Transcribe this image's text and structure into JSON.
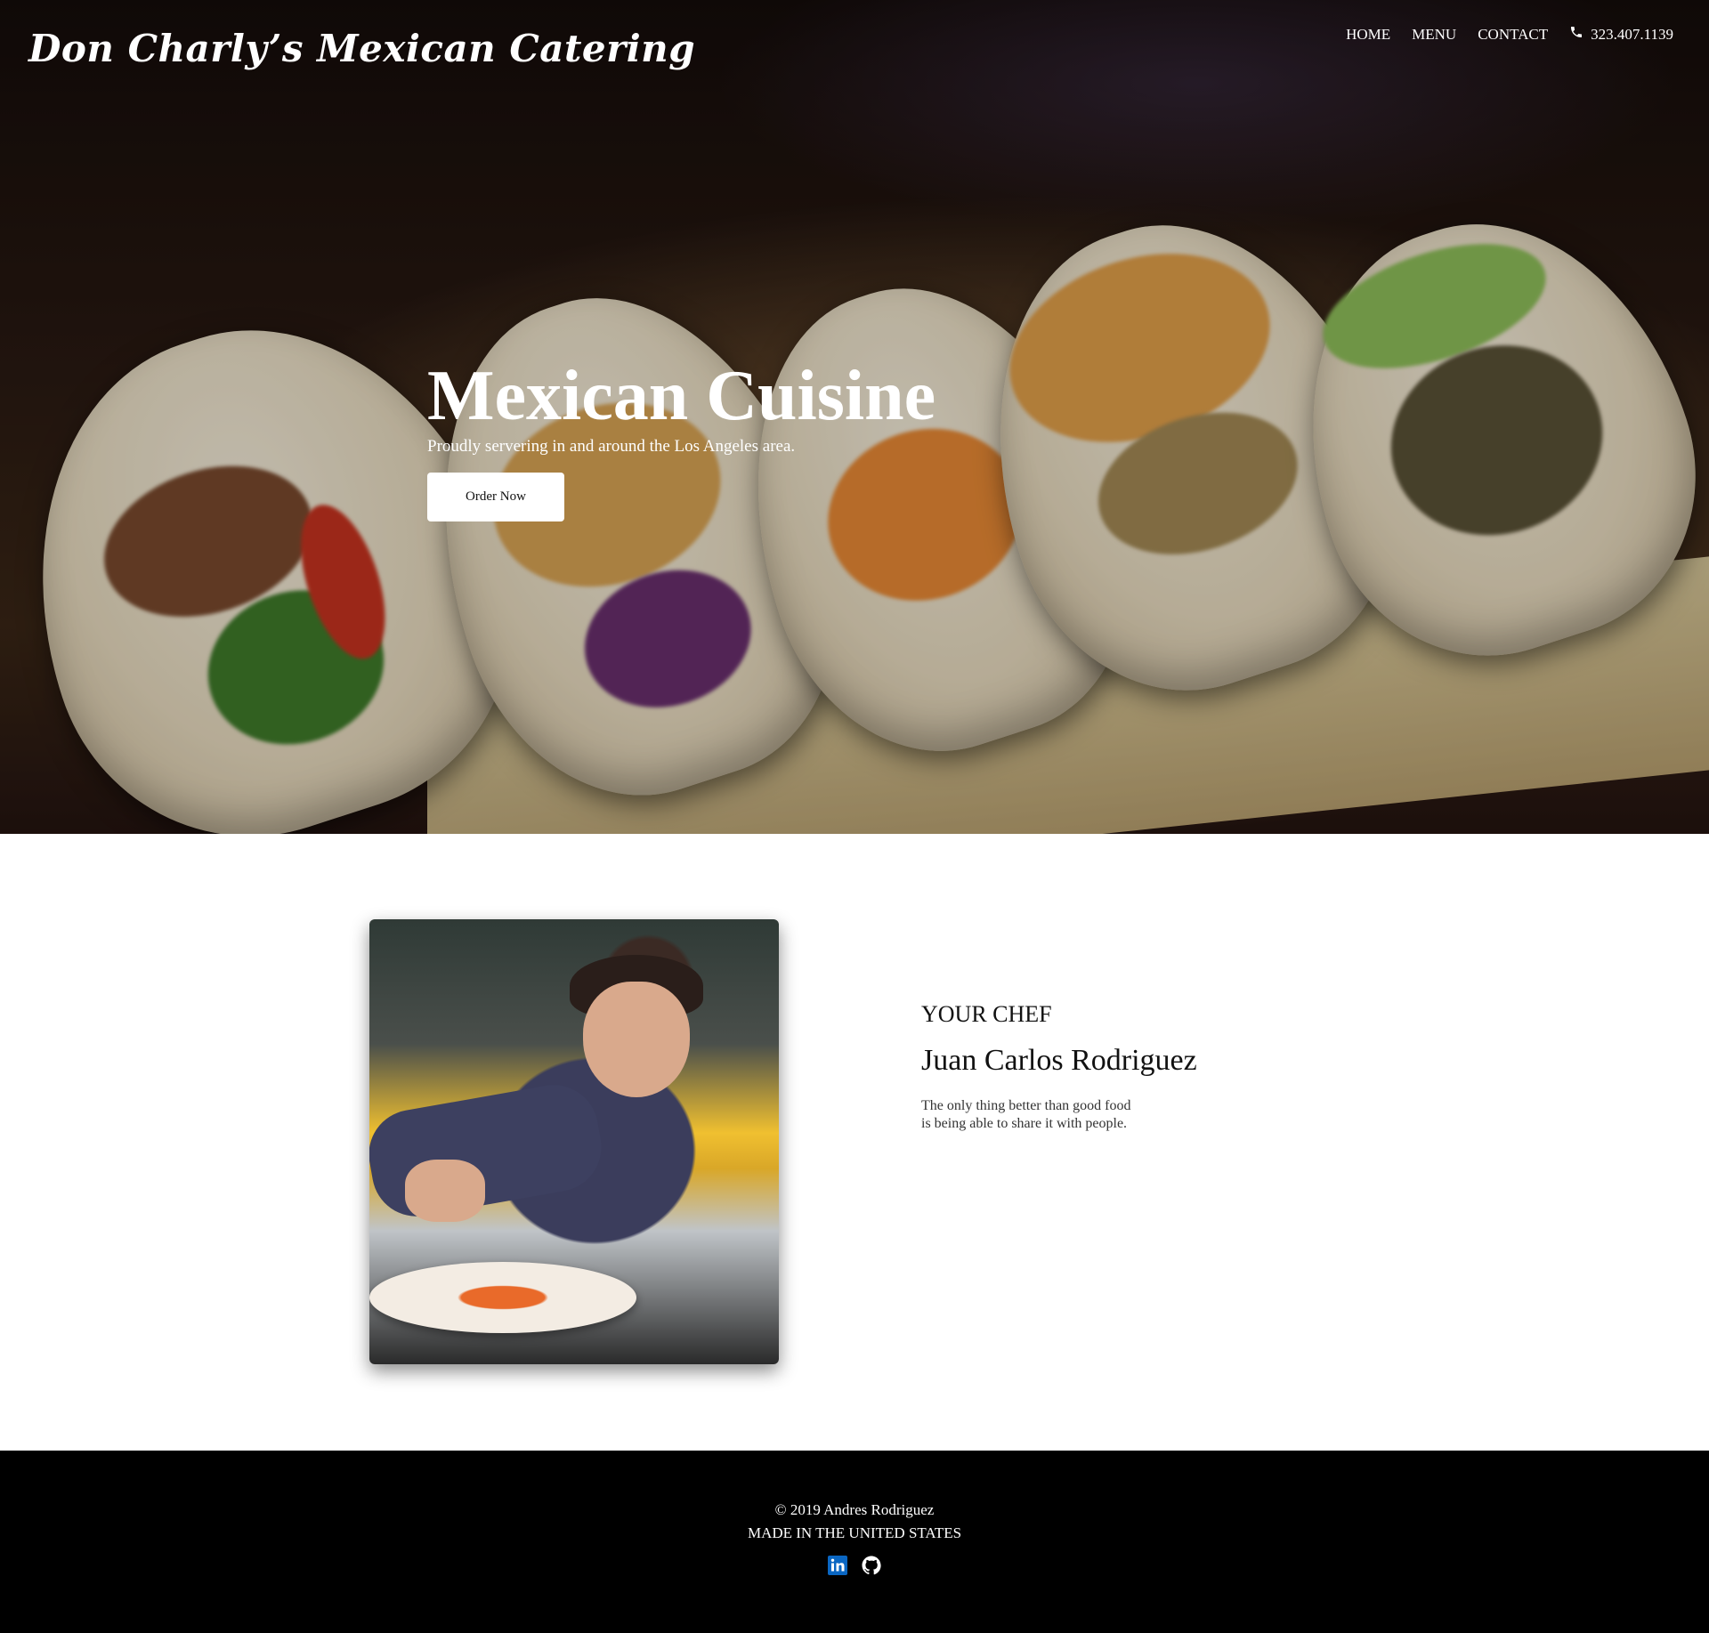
{
  "header": {
    "logo": "Don Charly’s Mexican Catering",
    "nav": [
      {
        "label": "HOME"
      },
      {
        "label": "MENU"
      },
      {
        "label": "CONTACT"
      }
    ],
    "phone": "323.407.1139",
    "phone_icon": "phone-icon"
  },
  "hero": {
    "title": "Mexican Cuisine",
    "subtitle": "Proudly servering in and around the Los Angeles area.",
    "cta": "Order Now"
  },
  "chef": {
    "eyebrow": "YOUR CHEF",
    "name": "Juan Carlos Rodriguez",
    "quote_line1": "The only thing better than good food",
    "quote_line2": "is being able to share it with people."
  },
  "footer": {
    "copyright": "© 2019 Andres Rodriguez",
    "made": "MADE IN THE UNITED STATES",
    "icons": [
      "linkedin-icon",
      "github-icon"
    ]
  },
  "colors": {
    "linkedin": "#0a66c2",
    "footer_bg": "#000000"
  }
}
